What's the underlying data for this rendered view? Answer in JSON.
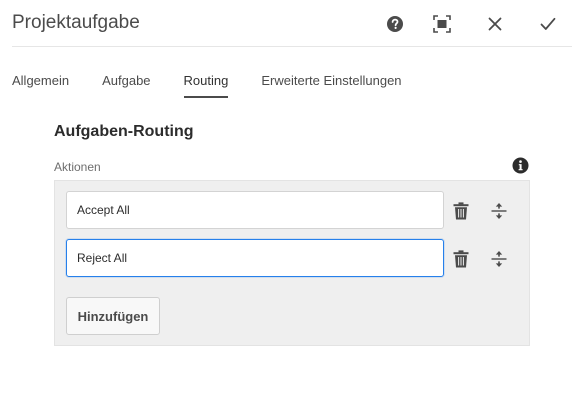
{
  "dialog": {
    "title": "Projektaufgabe",
    "header_icons": [
      "help-icon",
      "fullscreen-icon",
      "close-icon",
      "checkmark-icon"
    ]
  },
  "tabs": [
    {
      "label": "Allgemein",
      "active": false
    },
    {
      "label": "Aufgabe",
      "active": false
    },
    {
      "label": "Routing",
      "active": true
    },
    {
      "label": "Erweiterte Einstellungen",
      "active": false
    }
  ],
  "section": {
    "title": "Aufgaben-Routing",
    "field_label": "Aktionen",
    "info_icon": "info-icon"
  },
  "actions": {
    "items": [
      {
        "value": "Accept All",
        "focused": false
      },
      {
        "value": "Reject All",
        "focused": true
      }
    ],
    "add_label": "Hinzufügen"
  },
  "colors": {
    "focus_border": "#2680eb",
    "multifield_bg": "#efefef",
    "icon": "#4b4b4b"
  }
}
